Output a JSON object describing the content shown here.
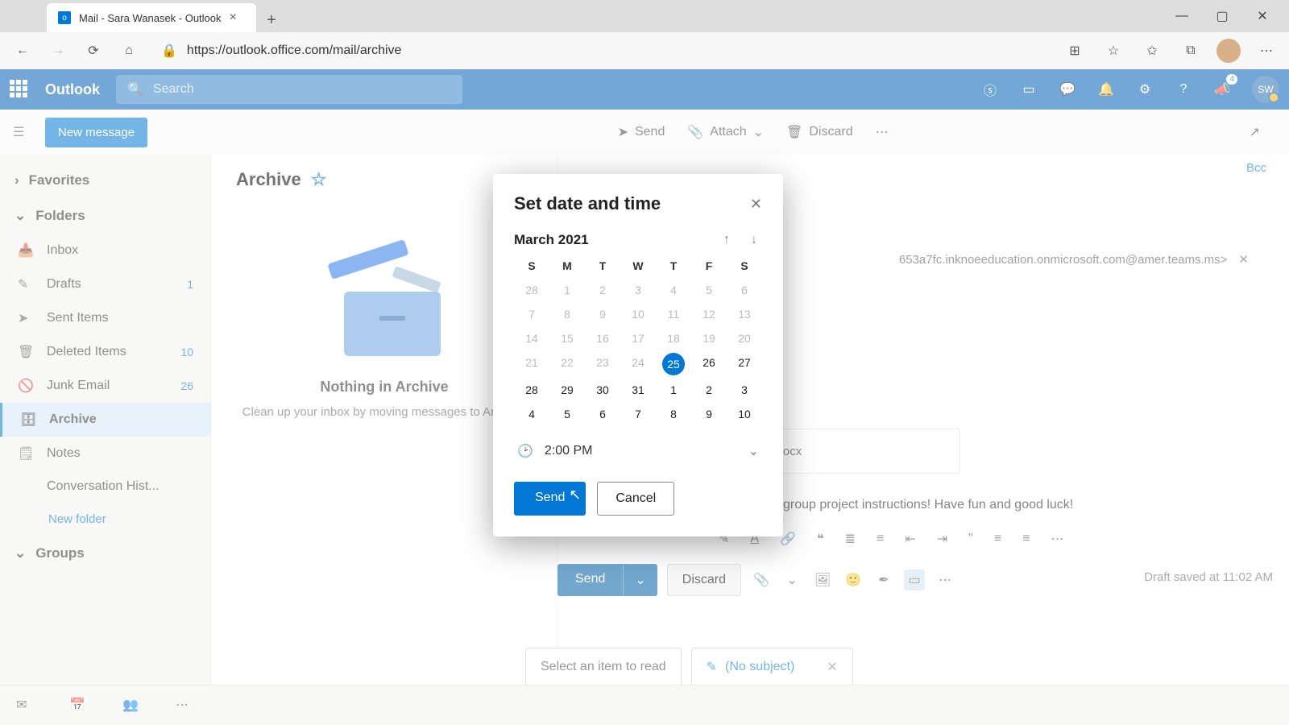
{
  "browser": {
    "tab_title": "Mail - Sara Wanasek - Outlook",
    "url": "https://outlook.office.com/mail/archive"
  },
  "header": {
    "brand": "Outlook",
    "search_placeholder": "Search",
    "notif_count": "4",
    "user_initials": "SW"
  },
  "commandbar": {
    "new_message": "New message",
    "send": "Send",
    "attach": "Attach",
    "discard": "Discard"
  },
  "sidebar": {
    "favorites": "Favorites",
    "folders_label": "Folders",
    "folders": [
      {
        "name": "Inbox",
        "count": ""
      },
      {
        "name": "Drafts",
        "count": "1"
      },
      {
        "name": "Sent Items",
        "count": ""
      },
      {
        "name": "Deleted Items",
        "count": "10"
      },
      {
        "name": "Junk Email",
        "count": "26"
      },
      {
        "name": "Archive",
        "count": ""
      },
      {
        "name": "Notes",
        "count": ""
      },
      {
        "name": "Conversation Hist...",
        "count": ""
      }
    ],
    "new_folder": "New folder",
    "groups": "Groups"
  },
  "msglist": {
    "title": "Archive",
    "empty_title": "Nothing in Archive",
    "empty_sub": "Clean up your inbox by moving messages to Archive."
  },
  "compose": {
    "bcc": "Bcc",
    "recipient_suffix": "653a7fc.inknoeeducation.onmicrosoft.com@amer.teams.ms>",
    "attachment_name": "ons.docx",
    "body_fragment": "r your next group project instructions! Have fun and good luck!",
    "send": "Send",
    "discard": "Discard",
    "draft_saved": "Draft saved at 11:02 AM"
  },
  "bottom_tabs": {
    "select_item": "Select an item to read",
    "no_subject": "(No subject)"
  },
  "modal": {
    "title": "Set date and time",
    "month": "March 2021",
    "dow": [
      "S",
      "M",
      "T",
      "W",
      "T",
      "F",
      "S"
    ],
    "weeks": [
      [
        "28",
        "1",
        "2",
        "3",
        "4",
        "5",
        "6"
      ],
      [
        "7",
        "8",
        "9",
        "10",
        "11",
        "12",
        "13"
      ],
      [
        "14",
        "15",
        "16",
        "17",
        "18",
        "19",
        "20"
      ],
      [
        "21",
        "22",
        "23",
        "24",
        "25",
        "26",
        "27"
      ],
      [
        "28",
        "29",
        "30",
        "31",
        "1",
        "2",
        "3"
      ],
      [
        "4",
        "5",
        "6",
        "7",
        "8",
        "9",
        "10"
      ]
    ],
    "selected": "25",
    "time": "2:00 PM",
    "send": "Send",
    "cancel": "Cancel"
  }
}
